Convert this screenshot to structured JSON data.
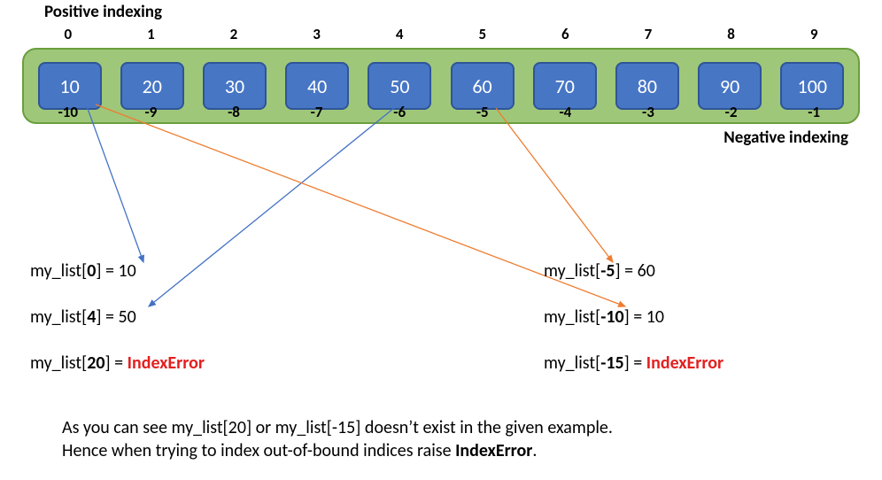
{
  "titles": {
    "positive": "Positive indexing",
    "negative": "Negative indexing"
  },
  "array": {
    "positive_indices": [
      "0",
      "1",
      "2",
      "3",
      "4",
      "5",
      "6",
      "7",
      "8",
      "9"
    ],
    "values": [
      "10",
      "20",
      "30",
      "40",
      "50",
      "60",
      "70",
      "80",
      "90",
      "100"
    ],
    "negative_indices": [
      "-10",
      "-9",
      "-8",
      "-7",
      "-6",
      "-5",
      "-4",
      "-3",
      "-2",
      "-1"
    ]
  },
  "examples": {
    "left": [
      {
        "prefix": "my_list[",
        "key": "0",
        "mid": "] = ",
        "value": "10",
        "error": false
      },
      {
        "prefix": "my_list[",
        "key": "4",
        "mid": "] = ",
        "value": "50",
        "error": false
      },
      {
        "prefix": "my_list[",
        "key": "20",
        "mid": "] =  ",
        "value": "IndexError",
        "error": true
      }
    ],
    "right": [
      {
        "prefix": "my_list[",
        "key": "-5",
        "mid": "] = ",
        "value": "60",
        "error": false
      },
      {
        "prefix": "my_list[",
        "key": "-10",
        "mid": "] = ",
        "value": "10",
        "error": false
      },
      {
        "prefix": "my_list[",
        "key": "-15",
        "mid": "] = ",
        "value": "IndexError",
        "error": true
      }
    ]
  },
  "footer": {
    "line1": "As you can see my_list[20] or my_list[-15] doesn’t exist in the given example.",
    "line2_a": "Hence when trying to index out-of-bound indices raise ",
    "line2_b": "IndexError",
    "line2_c": "."
  },
  "chart_data": {
    "type": "table",
    "description": "Python list indexing diagram: positive and negative indices over a 10-element list",
    "list_variable": "my_list",
    "elements": [
      {
        "positive_index": 0,
        "negative_index": -10,
        "value": 10
      },
      {
        "positive_index": 1,
        "negative_index": -9,
        "value": 20
      },
      {
        "positive_index": 2,
        "negative_index": -8,
        "value": 30
      },
      {
        "positive_index": 3,
        "negative_index": -7,
        "value": 40
      },
      {
        "positive_index": 4,
        "negative_index": -6,
        "value": 50
      },
      {
        "positive_index": 5,
        "negative_index": -5,
        "value": 60
      },
      {
        "positive_index": 6,
        "negative_index": -4,
        "value": 70
      },
      {
        "positive_index": 7,
        "negative_index": -3,
        "value": 80
      },
      {
        "positive_index": 8,
        "negative_index": -2,
        "value": 90
      },
      {
        "positive_index": 9,
        "negative_index": -1,
        "value": 100
      }
    ],
    "lookups": [
      {
        "expr": "my_list[0]",
        "result": 10
      },
      {
        "expr": "my_list[4]",
        "result": 50
      },
      {
        "expr": "my_list[20]",
        "result": "IndexError"
      },
      {
        "expr": "my_list[-5]",
        "result": 60
      },
      {
        "expr": "my_list[-10]",
        "result": 10
      },
      {
        "expr": "my_list[-15]",
        "result": "IndexError"
      }
    ]
  },
  "colors": {
    "cell_fill": "#4776C5",
    "cell_border": "#2F5597",
    "container_fill": "#9FC77A",
    "container_border": "#6B9E3D",
    "error_text": "#E32020",
    "arrow_blue": "#4472C4",
    "arrow_orange": "#ED7D31"
  }
}
